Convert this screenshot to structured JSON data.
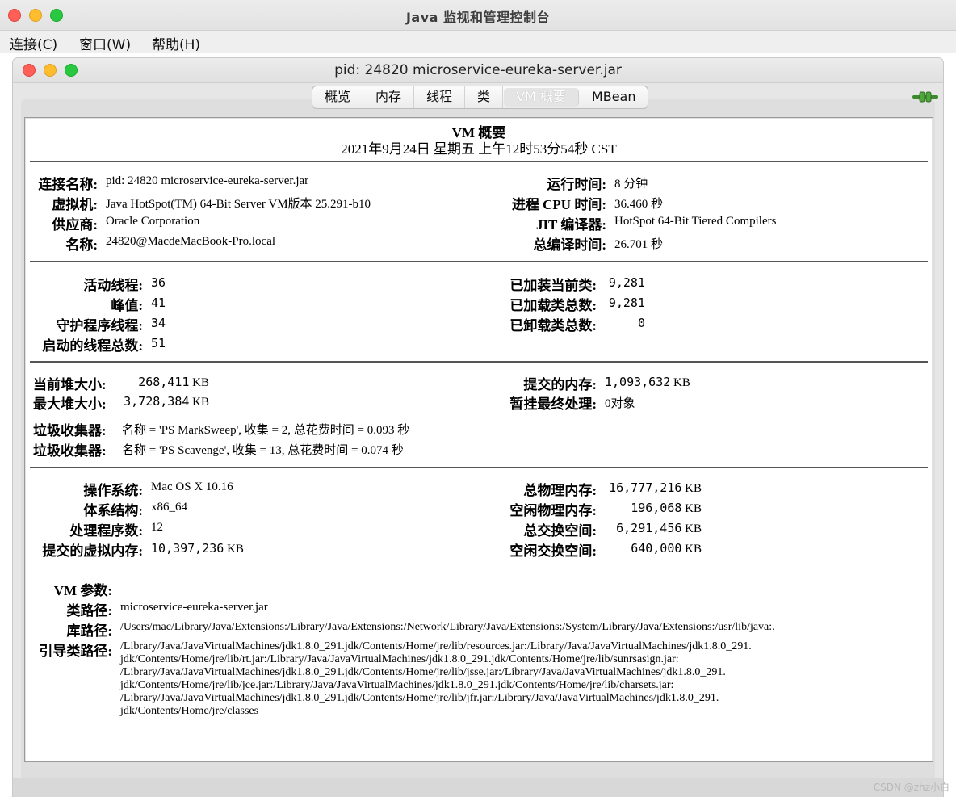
{
  "app": {
    "title": "Java 监视和管理控制台"
  },
  "menu": [
    "连接(C)",
    "窗口(W)",
    "帮助(H)"
  ],
  "window": {
    "title": "pid: 24820 microservice-eureka-server.jar"
  },
  "tabs": [
    "概览",
    "内存",
    "线程",
    "类",
    "VM 概要",
    "MBean"
  ],
  "active_tab": "VM 概要",
  "summary": {
    "title": "VM 概要",
    "datetime": "2021年9月24日 星期五 上午12时53分54秒 CST",
    "section1": {
      "conn_label": "连接名称:",
      "conn_value": "pid: 24820 microservice-eureka-server.jar",
      "vm_label": "虚拟机:",
      "vm_value": "Java HotSpot(TM) 64-Bit Server VM版本 25.291-b10",
      "vendor_label": "供应商:",
      "vendor_value": "Oracle Corporation",
      "name_label": "名称:",
      "name_value": "24820@MacdeMacBook-Pro.local",
      "uptime_label": "运行时间:",
      "uptime_value": "8 分钟",
      "cpu_label": "进程 CPU 时间:",
      "cpu_value": "36.460 秒",
      "jit_label": "JIT 编译器:",
      "jit_value": "HotSpot 64-Bit Tiered Compilers",
      "compile_label": "总编译时间:",
      "compile_value": "26.701 秒"
    },
    "section2": {
      "live_threads_label": "活动线程:",
      "live_threads": "36",
      "peak_label": "峰值:",
      "peak": "41",
      "daemon_label": "守护程序线程:",
      "daemon": "34",
      "started_label": "启动的线程总数:",
      "started": "51",
      "loaded_label": "已加装当前类:",
      "loaded": "9,281",
      "total_loaded_label": "已加载类总数:",
      "total_loaded": "9,281",
      "unloaded_label": "已卸载类总数:",
      "unloaded": "0"
    },
    "section3": {
      "heap_label": "当前堆大小:",
      "heap": "268,411",
      "max_heap_label": "最大堆大小:",
      "max_heap": "3,728,384",
      "committed_label": "提交的内存:",
      "committed": "1,093,632",
      "pending_label": "暂挂最终处理:",
      "pending": "0对象",
      "unit": "KB",
      "gc1_label": "垃圾收集器:",
      "gc1": "名称 = 'PS MarkSweep', 收集 = 2, 总花费时间 = 0.093 秒",
      "gc2_label": "垃圾收集器:",
      "gc2": "名称 = 'PS Scavenge', 收集 = 13, 总花费时间 = 0.074 秒"
    },
    "section4": {
      "os_label": "操作系统:",
      "os": "Mac OS X 10.16",
      "arch_label": "体系结构:",
      "arch": "x86_64",
      "cpus_label": "处理程序数:",
      "cpus": "12",
      "vmem_label": "提交的虚拟内存:",
      "vmem": "10,397,236",
      "phys_label": "总物理内存:",
      "phys": "16,777,216",
      "free_phys_label": "空闲物理内存:",
      "free_phys": "196,068",
      "swap_label": "总交换空间:",
      "swap": "6,291,456",
      "free_swap_label": "空闲交换空间:",
      "free_swap": "640,000",
      "unit": "KB"
    },
    "section5": {
      "vm_args_label": "VM 参数:",
      "classpath_label": "类路径:",
      "classpath": "microservice-eureka-server.jar",
      "libpath_label": "库路径:",
      "libpath": "/Users/mac/Library/Java/Extensions:/Library/Java/Extensions:/Network/Library/Java/Extensions:/System/Library/Java/Extensions:/usr/lib/java:.",
      "bootpath_label": "引导类路径:",
      "bootpath_lines": [
        "/Library/Java/JavaVirtualMachines/jdk1.8.0_291.jdk/Contents/Home/jre/lib/resources.jar:/Library/Java/JavaVirtualMachines/jdk1.8.0_291.",
        "jdk/Contents/Home/jre/lib/rt.jar:/Library/Java/JavaVirtualMachines/jdk1.8.0_291.jdk/Contents/Home/jre/lib/sunrsasign.jar:",
        "/Library/Java/JavaVirtualMachines/jdk1.8.0_291.jdk/Contents/Home/jre/lib/jsse.jar:/Library/Java/JavaVirtualMachines/jdk1.8.0_291.",
        "jdk/Contents/Home/jre/lib/jce.jar:/Library/Java/JavaVirtualMachines/jdk1.8.0_291.jdk/Contents/Home/jre/lib/charsets.jar:",
        "/Library/Java/JavaVirtualMachines/jdk1.8.0_291.jdk/Contents/Home/jre/lib/jfr.jar:/Library/Java/JavaVirtualMachines/jdk1.8.0_291.",
        "jdk/Contents/Home/jre/classes"
      ]
    }
  },
  "watermark": "CSDN @zhz小白"
}
